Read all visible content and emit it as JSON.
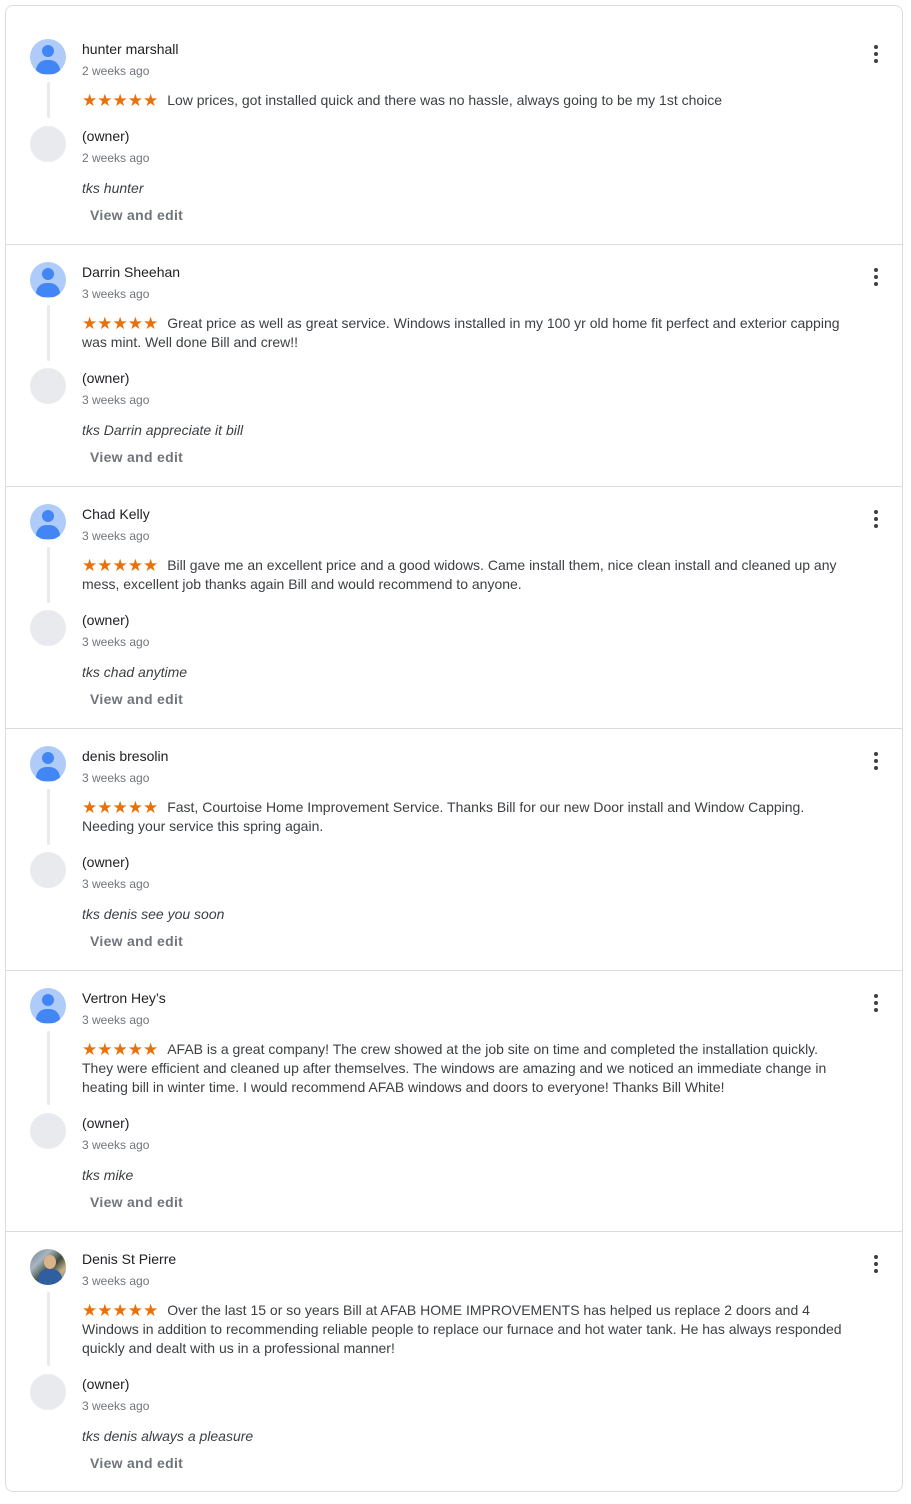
{
  "reviews": [
    {
      "author": "hunter marshall",
      "time": "2 weeks ago",
      "stars": "★★★★★",
      "rating": 5,
      "text": "Low prices, got installed quick and there was no hassle, always going to be my 1st choice",
      "owner_label": "(owner)",
      "owner_time": "2 weeks ago",
      "reply": "tks hunter",
      "action": "View and edit",
      "avatar": "person-icon"
    },
    {
      "author": "Darrin Sheehan",
      "time": "3 weeks ago",
      "stars": "★★★★★",
      "rating": 5,
      "text": "Great price as well as great service. Windows installed in my 100 yr old home fit perfect and exterior capping was mint. Well done Bill and crew!!",
      "owner_label": "(owner)",
      "owner_time": "3 weeks ago",
      "reply": "tks Darrin appreciate it bill",
      "action": "View and edit",
      "avatar": "person-icon"
    },
    {
      "author": "Chad Kelly",
      "time": "3 weeks ago",
      "stars": "★★★★★",
      "rating": 5,
      "text": "Bill gave me an excellent price and a good widows. Came install them, nice clean install and cleaned up any mess, excellent job thanks again Bill and would recommend to anyone.",
      "owner_label": "(owner)",
      "owner_time": "3 weeks ago",
      "reply": "tks chad anytime",
      "action": "View and edit",
      "avatar": "person-icon"
    },
    {
      "author": "denis bresolin",
      "time": "3 weeks ago",
      "stars": "★★★★★",
      "rating": 5,
      "text": "Fast, Courtoise Home Improvement Service. Thanks Bill for our new Door install and Window Capping. Needing your service this spring again.",
      "owner_label": "(owner)",
      "owner_time": "3 weeks ago",
      "reply": "tks denis see you soon",
      "action": "View and edit",
      "avatar": "person-icon"
    },
    {
      "author": "Vertron Hey’s",
      "time": "3 weeks ago",
      "stars": "★★★★★",
      "rating": 5,
      "text": "AFAB is a great company! The crew showed at the job site on time and completed the installation quickly. They were efficient and cleaned up after themselves. The windows are amazing and we noticed an immediate change in heating bill in winter time. I would recommend AFAB windows and doors to everyone! Thanks Bill White!",
      "owner_label": "(owner)",
      "owner_time": "3 weeks ago",
      "reply": "tks mike",
      "action": "View and edit",
      "avatar": "person-icon"
    },
    {
      "author": "Denis St Pierre",
      "time": "3 weeks ago",
      "stars": "★★★★★",
      "rating": 5,
      "text": "Over the last 15 or so years Bill at AFAB HOME IMPROVEMENTS has helped us replace 2 doors and 4 Windows in addition to recommending reliable people to replace our furnace and hot water tank. He has always responded quickly and dealt with us in a professional manner!",
      "owner_label": "(owner)",
      "owner_time": "3 weeks ago",
      "reply": "tks denis always a pleasure",
      "action": "View and edit",
      "avatar": "profile-photo"
    }
  ],
  "colors": {
    "star": "#e8710a",
    "avatar_bg": "#aecbfa",
    "avatar_fg": "#4285f4",
    "muted_text": "#70757a",
    "divider": "#dadce0"
  }
}
